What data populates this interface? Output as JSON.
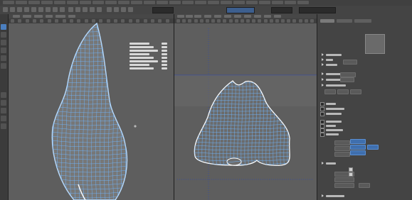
{
  "menubar": {
    "item_count": 24
  },
  "shelf": {
    "button_count": 18
  },
  "toolbox": {
    "tools": [
      "select-tool",
      "lasso-tool",
      "paint-tool",
      "move-tool",
      "rotate-tool",
      "scale-tool"
    ]
  },
  "viewport_left": {
    "name": "perspective-viewport",
    "stats": [
      {
        "label": "",
        "value": ""
      },
      {
        "label": "",
        "value": ""
      },
      {
        "label": "",
        "value": ""
      },
      {
        "label": "",
        "value": ""
      },
      {
        "label": "",
        "value": ""
      },
      {
        "label": "",
        "value": ""
      },
      {
        "label": "",
        "value": ""
      },
      {
        "label": "",
        "value": ""
      }
    ]
  },
  "viewport_right": {
    "name": "front-ortho-viewport",
    "annotation": ""
  },
  "channel_box": {
    "tabs": [
      "",
      "",
      ""
    ],
    "sections": [
      {
        "label": ""
      },
      {
        "label": ""
      },
      {
        "label": ""
      },
      {
        "label": ""
      },
      {
        "label": ""
      },
      {
        "label": ""
      },
      {
        "label": ""
      },
      {
        "label": ""
      },
      {
        "label": ""
      },
      {
        "label": ""
      }
    ]
  },
  "colors": {
    "accent_blue": "#3f6fae",
    "wire_blue": "#6fb7ff",
    "viewport_bg": "#5e5e5e",
    "panel_bg": "#444444"
  }
}
